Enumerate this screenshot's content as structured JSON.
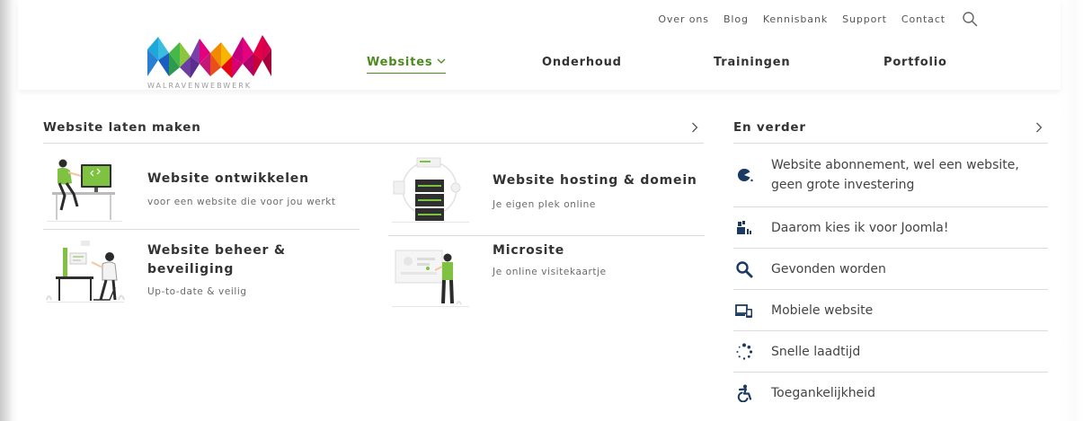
{
  "topnav": {
    "links": [
      "Over ons",
      "Blog",
      "Kennisbank",
      "Support",
      "Contact"
    ],
    "search_icon": "search-icon"
  },
  "logo": {
    "tagline": "WALRAVENWEBWERK"
  },
  "mainnav": {
    "items": [
      {
        "label": "Websites",
        "active": true
      },
      {
        "label": "Onderhoud",
        "active": false
      },
      {
        "label": "Trainingen",
        "active": false
      },
      {
        "label": "Portfolio",
        "active": false
      }
    ]
  },
  "left": {
    "title": "Website laten maken",
    "cards": [
      {
        "title": "Website ontwikkelen",
        "subtitle": "voor een website die voor jou werkt"
      },
      {
        "title": "Website hosting & domein",
        "subtitle": "Je eigen plek online"
      },
      {
        "title_line1": "Website beheer &",
        "title_line2": "beveiliging",
        "subtitle": "Up-to-date & veilig"
      },
      {
        "title": "Microsite",
        "subtitle": "Je online visitekaartje"
      }
    ]
  },
  "right": {
    "title": "En verder",
    "items": [
      {
        "icon": "pacman-icon",
        "line1": "Website abonnement, wel een website,",
        "line2": "geen grote investering"
      },
      {
        "icon": "joomla-icon",
        "line1": "Daarom kies ik voor Joomla!"
      },
      {
        "icon": "search-icon",
        "line1": "Gevonden worden"
      },
      {
        "icon": "devices-icon",
        "line1": "Mobiele website"
      },
      {
        "icon": "spinner-icon",
        "line1": "Snelle laadtijd"
      },
      {
        "icon": "accessibility-icon",
        "line1": "Toegankelijkheid"
      }
    ]
  },
  "colors": {
    "accent_green": "#4d8a1f",
    "navy": "#1b3a63",
    "text": "#333333",
    "divider": "#dcdcdc"
  }
}
